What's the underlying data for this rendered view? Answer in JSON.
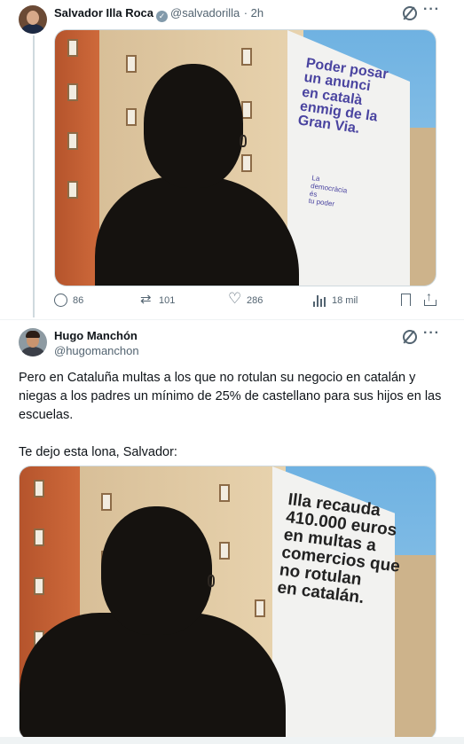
{
  "tweets": [
    {
      "author_name": "Salvador Illa Roca",
      "handle": "@salvadorilla",
      "time": "· 2h",
      "verified": true,
      "image": {
        "banner_lines": [
          "Poder posar",
          "un anunci",
          "en català",
          "enmig de la",
          "Gran Via."
        ],
        "banner_footer": [
          "La",
          "democràcia",
          "és",
          "tu poder"
        ]
      },
      "stats": {
        "replies": "86",
        "reposts": "101",
        "likes": "286",
        "views": "18 mil"
      }
    },
    {
      "author_name": "Hugo Manchón",
      "handle": "@hugomanchon",
      "text": "Pero en Cataluña multas a los que no rotulan su negocio en catalán y niegas a los padres un mínimo de 25% de castellano para sus hijos en las escuelas.\n\nTe dejo esta lona, Salvador:",
      "image": {
        "banner_lines": [
          "Illa recauda",
          "410.000 euros",
          "en multas a",
          "comercios que",
          "no rotulan",
          "en catalán."
        ]
      }
    }
  ],
  "icons": {
    "more": "more-icon",
    "grok": "grok-icon",
    "reply": "reply-icon",
    "repost": "repost-icon",
    "like": "like-icon",
    "views": "views-icon",
    "bookmark": "bookmark-icon",
    "share": "share-icon"
  },
  "colors": {
    "text_primary": "#0f1419",
    "text_secondary": "#536471",
    "thread_line": "#cfd9de",
    "banner1_text": "#4a44a0",
    "banner2_text": "#222222"
  }
}
